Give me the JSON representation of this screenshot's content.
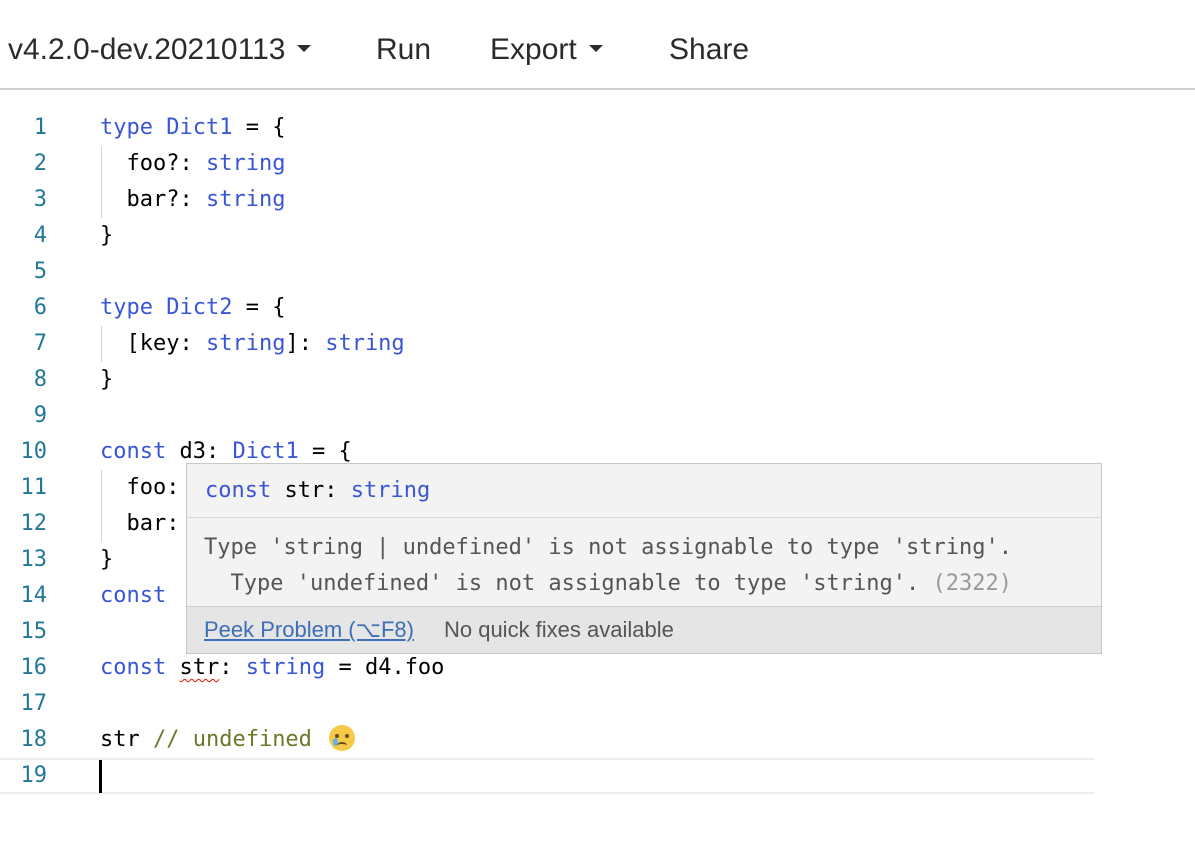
{
  "toolbar": {
    "version_label": "v4.2.0-dev.20210113",
    "run_label": "Run",
    "export_label": "Export",
    "share_label": "Share"
  },
  "editor": {
    "line_numbers": [
      "1",
      "2",
      "3",
      "4",
      "5",
      "6",
      "7",
      "8",
      "9",
      "10",
      "11",
      "12",
      "13",
      "14",
      "15",
      "16",
      "17",
      "18",
      "19"
    ],
    "lines": {
      "l1": {
        "kw": "type",
        "name": " Dict1",
        "rest": " = {"
      },
      "l2": {
        "prop": "  foo?: ",
        "type": "string"
      },
      "l3": {
        "prop": "  bar?: ",
        "type": "string"
      },
      "l4": {
        "text": "}"
      },
      "l6": {
        "kw": "type",
        "name": " Dict2",
        "rest": " = {"
      },
      "l7": {
        "open": "  [key: ",
        "type1": "string",
        "mid": "]: ",
        "type2": "string"
      },
      "l8": {
        "text": "}"
      },
      "l10": {
        "kw": "const",
        "mid": " d3: ",
        "type": "Dict1",
        "rest": " = {"
      },
      "l11": {
        "text": "  foo:"
      },
      "l12": {
        "text": "  bar:"
      },
      "l13": {
        "text": "}"
      },
      "l14": {
        "kw": "const"
      },
      "l16": {
        "kw": "const",
        "sp": " ",
        "var": "str",
        "colon": ": ",
        "type": "string",
        "rest": " = d4.foo"
      },
      "l18": {
        "var": "str ",
        "comment": "// undefined"
      }
    }
  },
  "hover": {
    "sig_kw": "const",
    "sig_rest": " str: ",
    "sig_type": "string",
    "message_line1": "Type 'string | undefined' is not assignable to type 'string'.",
    "message_line2": "  Type 'undefined' is not assignable to type 'string'. ",
    "error_code": "(2322)",
    "peek_label": "Peek Problem (⌥F8)",
    "no_fix_label": "No quick fixes available"
  },
  "icons": {
    "caret": "chevron-down-icon",
    "emoji": "crying-face-icon"
  }
}
